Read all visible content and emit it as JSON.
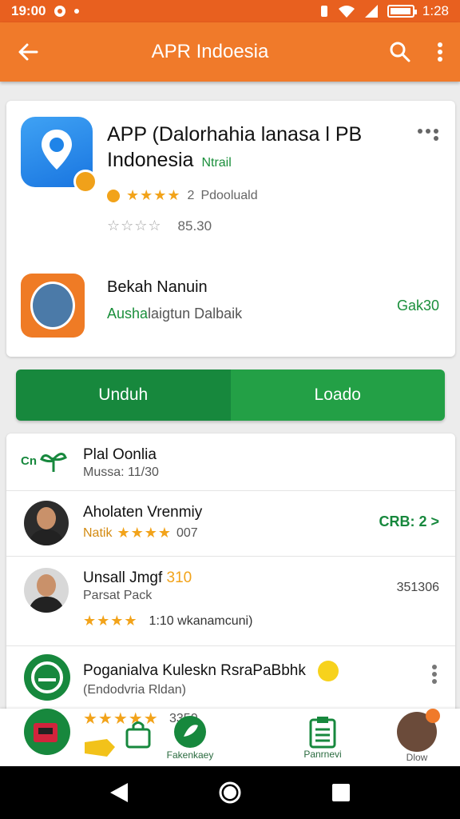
{
  "status_bar": {
    "time": "19:00",
    "right_time": "1:28"
  },
  "app_bar": {
    "title": "APR Indoesia"
  },
  "app_card": {
    "title_line1": "APP (Dalorhahia lanasa l PB",
    "title_line2": "Indonesia",
    "tag": "Ntrail",
    "stars": "★★★★",
    "rating_value": "2",
    "rating_label": "Pdooluald",
    "stars2": "☆☆☆☆",
    "rating2_value": "85.30",
    "developer_name": "Bekah Nanuin",
    "developer_sub_green": "Ausha",
    "developer_sub": "laigtun Dalbaik",
    "developer_code": "Gak30",
    "colors": {
      "accent": "#f07a2a",
      "green": "#17883d",
      "star": "#f2a31a"
    }
  },
  "buttons": {
    "primary": "Unduh",
    "secondary": "Loado"
  },
  "list": {
    "items": [
      {
        "title": "Plal Oonlia",
        "sub": "Mussa: 11/30",
        "icon_text": "Cn"
      },
      {
        "title": "Aholaten Vrenmiy",
        "stars": "★★★★",
        "stars_prefix": "Natik",
        "value": "007",
        "right": "CRB: 2"
      },
      {
        "title": "Unsall Jmgf",
        "title_suffix": "310",
        "sub": "Parsat Pack",
        "stars": "★★★★",
        "extra": "1:10 wkanamcuni)",
        "right": "351306"
      },
      {
        "title": "Poganialva Kuleskn RsraPaBbhk",
        "sub": "(Endodvria Rldan)"
      }
    ]
  },
  "bottom_nav": {
    "rating_text": "3350",
    "stars": "★★★★★",
    "items": [
      {
        "label": "Fakenkaey"
      },
      {
        "label": "Panrnevi"
      },
      {
        "label": "Dlow"
      }
    ]
  }
}
